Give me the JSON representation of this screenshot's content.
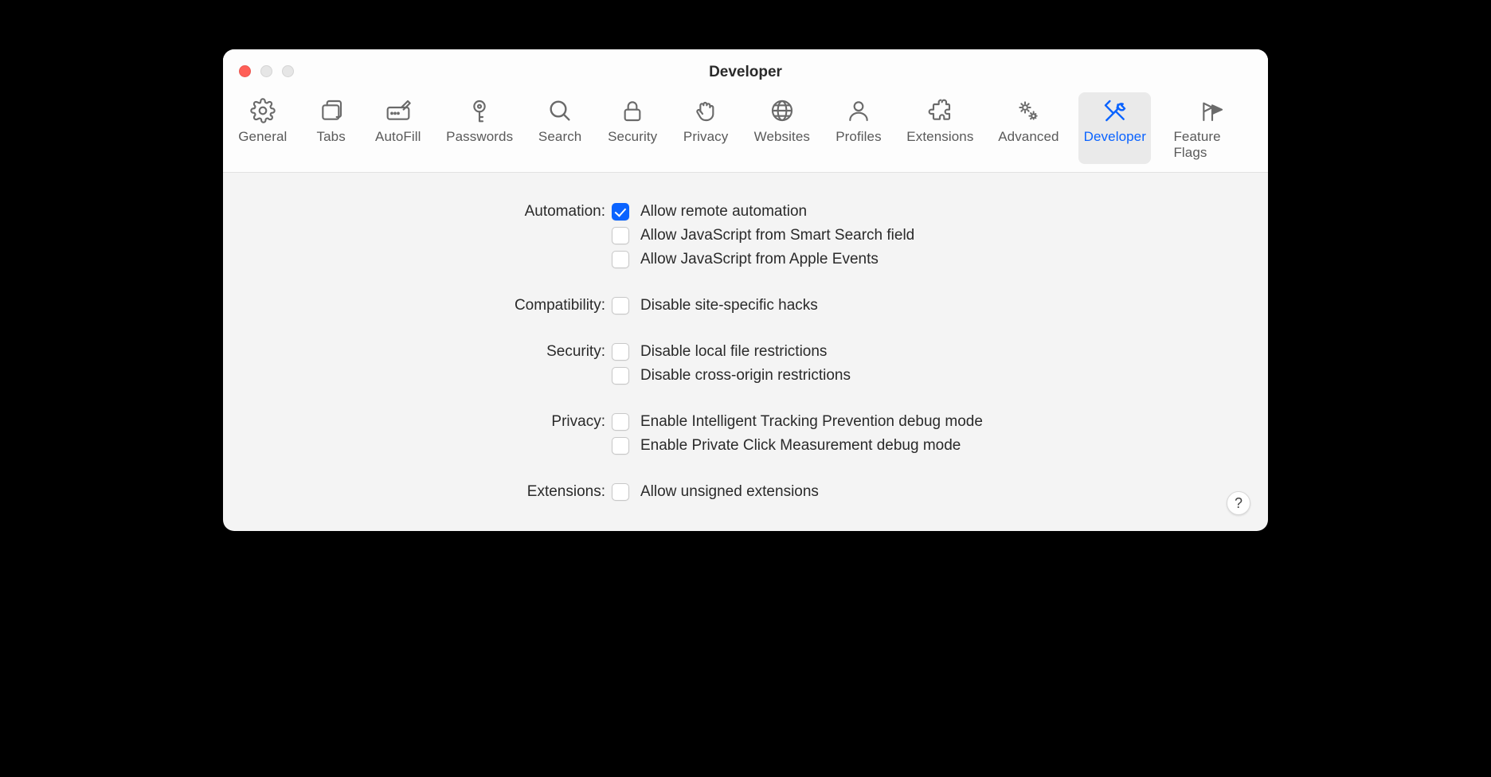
{
  "window": {
    "title": "Developer"
  },
  "tabs": [
    {
      "id": "general",
      "label": "General"
    },
    {
      "id": "tabs",
      "label": "Tabs"
    },
    {
      "id": "autofill",
      "label": "AutoFill"
    },
    {
      "id": "passwords",
      "label": "Passwords"
    },
    {
      "id": "search",
      "label": "Search"
    },
    {
      "id": "security",
      "label": "Security"
    },
    {
      "id": "privacy",
      "label": "Privacy"
    },
    {
      "id": "websites",
      "label": "Websites"
    },
    {
      "id": "profiles",
      "label": "Profiles"
    },
    {
      "id": "extensions",
      "label": "Extensions"
    },
    {
      "id": "advanced",
      "label": "Advanced"
    },
    {
      "id": "developer",
      "label": "Developer",
      "active": true
    },
    {
      "id": "feature-flags",
      "label": "Feature Flags"
    }
  ],
  "sections": {
    "automation": {
      "label": "Automation:",
      "options": [
        {
          "label": "Allow remote automation",
          "checked": true
        },
        {
          "label": "Allow JavaScript from Smart Search field",
          "checked": false
        },
        {
          "label": "Allow JavaScript from Apple Events",
          "checked": false
        }
      ]
    },
    "compatibility": {
      "label": "Compatibility:",
      "options": [
        {
          "label": "Disable site-specific hacks",
          "checked": false
        }
      ]
    },
    "security": {
      "label": "Security:",
      "options": [
        {
          "label": "Disable local file restrictions",
          "checked": false
        },
        {
          "label": "Disable cross-origin restrictions",
          "checked": false
        }
      ]
    },
    "privacy": {
      "label": "Privacy:",
      "options": [
        {
          "label": "Enable Intelligent Tracking Prevention debug mode",
          "checked": false
        },
        {
          "label": "Enable Private Click Measurement debug mode",
          "checked": false
        }
      ]
    },
    "extensions": {
      "label": "Extensions:",
      "options": [
        {
          "label": "Allow unsigned extensions",
          "checked": false
        }
      ]
    }
  },
  "help": "?"
}
